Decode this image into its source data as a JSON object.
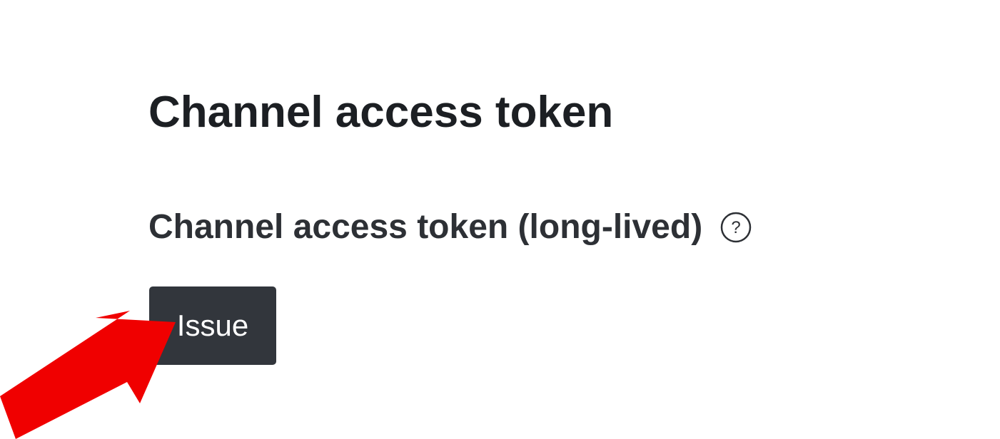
{
  "section": {
    "title": "Channel access token"
  },
  "token_field": {
    "label": "Channel access token (long-lived)",
    "help_icon": "question-circle-icon",
    "issue_button_label": "Issue"
  },
  "annotation": {
    "arrow_icon": "red-arrow-pointer-icon",
    "arrow_color": "#f00000"
  },
  "colors": {
    "button_bg": "#32363c",
    "title_text": "#1c1f23",
    "label_text": "#2d3035"
  }
}
